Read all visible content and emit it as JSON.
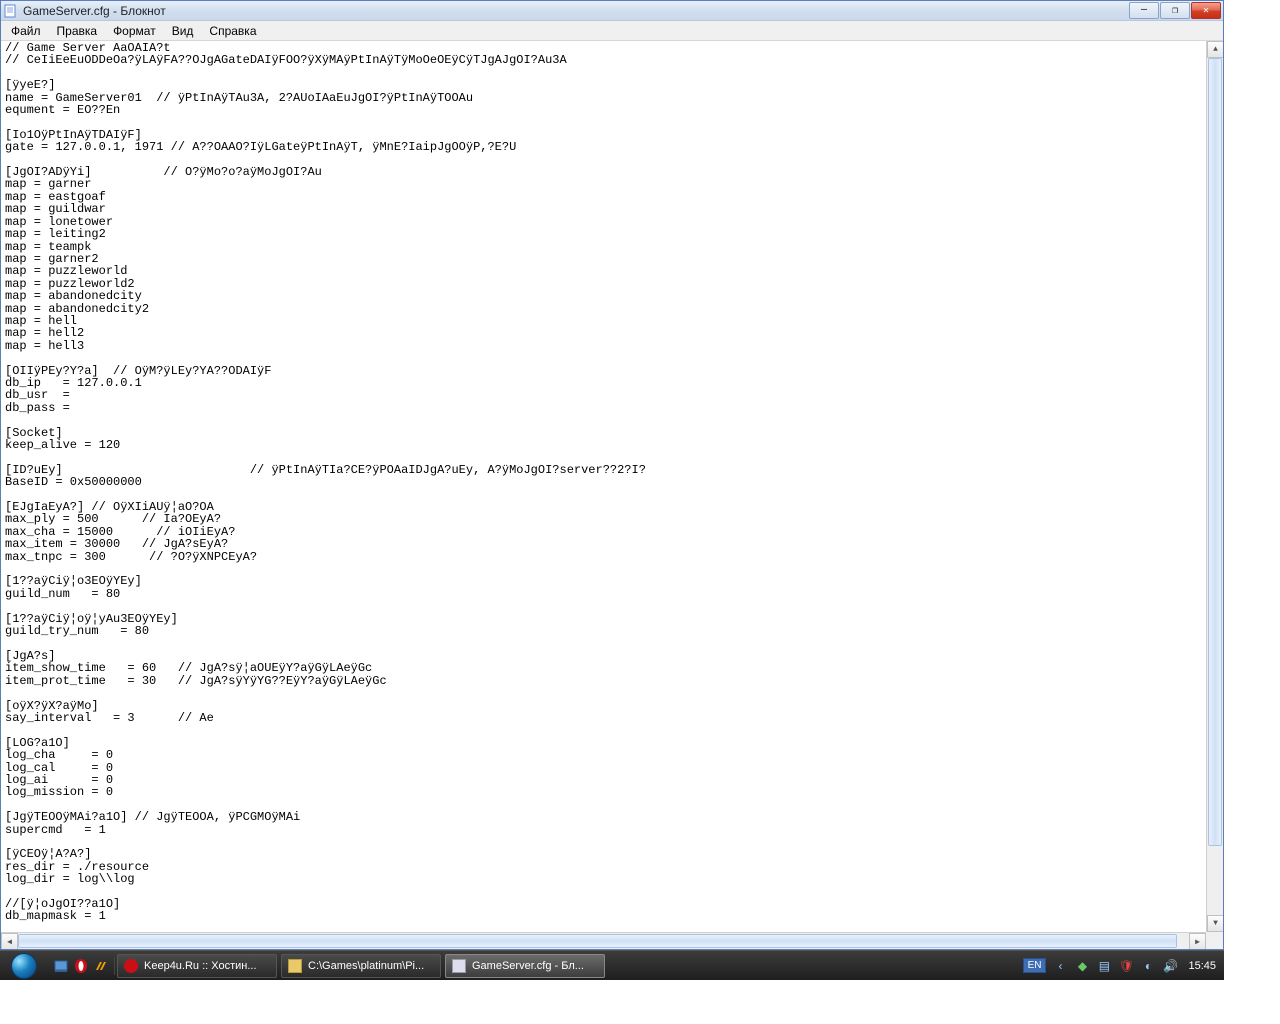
{
  "window": {
    "title": "GameServer.cfg - Блокнот",
    "min": "—",
    "max": "❐",
    "close": "✕"
  },
  "menu": {
    "file": "Файл",
    "edit": "Правка",
    "format": "Формат",
    "view": "Вид",
    "help": "Справка"
  },
  "content": "// Game Server AaOAIA?t\n// CeIiEeEuODDeOa?ÿLAÿFA??OJgAGateDAIÿFOO?ÿXÿMAÿPtInAÿTÿMoOeOEÿCÿTJgAJgOI?Au3A\n\n[ÿyeE?]\nname = GameServer01  // ÿPtInAÿTAu3A, 2?AUoIAaEuJgOI?ÿPtInAÿTOOAu\nequment = EO??En\n\n[Io1OÿPtInAÿTDAIÿF]\ngate = 127.0.0.1, 1971 // A??OAAO?IÿLGateÿPtInAÿT, ÿMnE?IaipJgOOÿP,?E?U\n\n[JgOI?ADÿYi]          // O?ÿMo?o?aÿMoJgOI?Au\nmap = garner\nmap = eastgoaf\nmap = guildwar\nmap = lonetower\nmap = leiting2\nmap = teampk\nmap = garner2\nmap = puzzleworld\nmap = puzzleworld2\nmap = abandonedcity\nmap = abandonedcity2\nmap = hell\nmap = hell2\nmap = hell3\n\n[OIIÿPEy?Y?a]  // OÿM?ÿLEy?YA??ODAIÿF\ndb_ip   = 127.0.0.1\ndb_usr  =\ndb_pass =\n\n[Socket]\nkeep_alive = 120\n\n[ID?uEy]                          // ÿPtInAÿTIa?CE?ÿPOAaIDJgA?uEy, A?ÿMoJgOI?server??2?I?\nBaseID = 0x50000000\n\n[EJgIaEyA?] // OÿXIiAUÿ¦aO?OA\nmax_ply = 500      // Ia?OEyA?\nmax_cha = 15000      // iOIiEyA?\nmax_item = 30000   // JgA?sEyA?\nmax_tnpc = 300      // ?O?ÿXNPCEyA?\n\n[1??aÿCiÿ¦o3EOÿYEy]\nguild_num   = 80\n\n[1??aÿCiÿ¦oÿ¦yAu3EOÿYEy]\nguild_try_num   = 80\n\n[JgA?s]\nitem_show_time   = 60   // JgA?sÿ¦aOUEÿY?aÿGÿLAeÿGc\nitem_prot_time   = 30   // JgA?sÿYÿYG??EÿY?aÿGÿLAeÿGc\n\n[oÿX?ÿX?aÿMo]\nsay_interval   = 3      // Ae\n\n[LOG?a1O]\nlog_cha     = 0\nlog_cal     = 0\nlog_ai      = 0\nlog_mission = 0\n\n[JgÿTEOOÿMAi?a1O] // JgÿTEOOA, ÿPCGMOÿMAi\nsupercmd   = 1\n\n[ÿCEOÿ¦A?A?]\nres_dir = ./resource\nlog_dir = log\\\\log\n\n//[ÿ¦oJgOI??a1O]\ndb_mapmask = 1",
  "taskbar": {
    "items": [
      {
        "label": "Keep4u.Ru :: Хостин...",
        "icon": "opera"
      },
      {
        "label": "C:\\Games\\platinum\\Pi...",
        "icon": "folder"
      },
      {
        "label": "GameServer.cfg - Бл...",
        "icon": "note"
      }
    ],
    "lang": "EN",
    "clock": "15:45"
  }
}
